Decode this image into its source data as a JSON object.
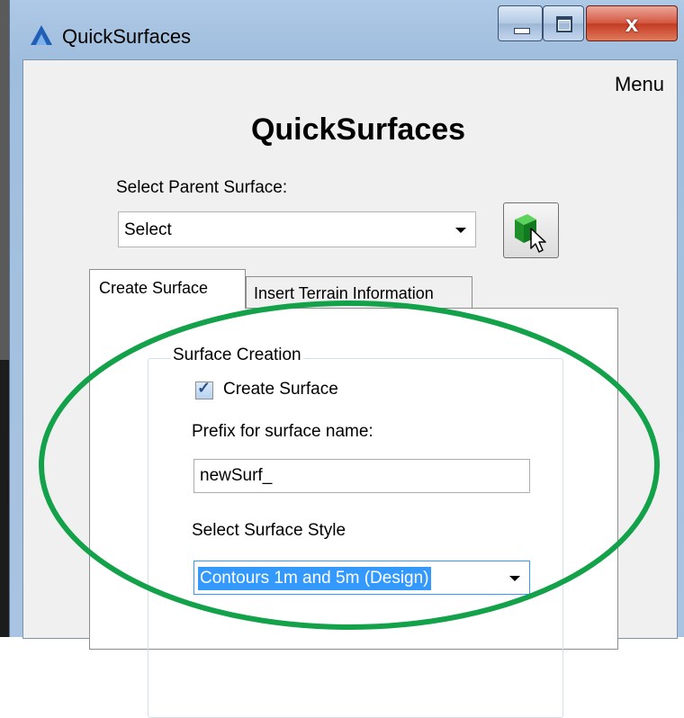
{
  "window": {
    "title": "QuickSurfaces",
    "close_glyph": "x",
    "icons": [
      "app-logo-icon",
      "minimize-icon",
      "maximize-icon",
      "close-icon"
    ]
  },
  "menu": {
    "label": "Menu"
  },
  "heading": "QuickSurfaces",
  "parent_surface": {
    "label": "Select Parent Surface:",
    "selected": "Select",
    "pick_icon": "green-cube-cursor-icon"
  },
  "tabs": [
    {
      "label": "Create Surface",
      "active": true
    },
    {
      "label": "Insert Terrain Information",
      "active": false
    }
  ],
  "surface_creation": {
    "group_title": "Surface Creation",
    "create_checkbox_label": "Create Surface",
    "create_checked": true,
    "prefix_label": "Prefix for surface name:",
    "prefix_value": "newSurf_",
    "style_label": "Select Surface Style",
    "style_selected": "Contours 1m and 5m (Design)"
  },
  "colors": {
    "annotation": "#13a14a",
    "selection": "#3399ff",
    "close_button": "#c9452c"
  }
}
